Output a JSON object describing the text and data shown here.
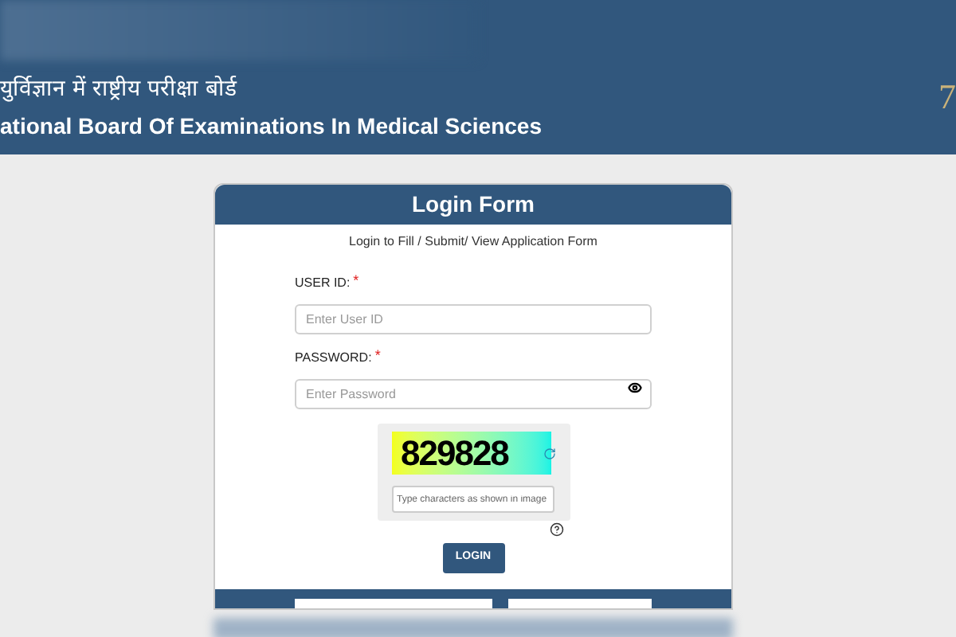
{
  "header": {
    "hindi_title": "युर्विज्ञान में राष्ट्रीय परीक्षा बोर्ड",
    "english_title": "ational Board Of Examinations In Medical Sciences",
    "logo_text": "7"
  },
  "login_form": {
    "title": "Login Form",
    "subtitle": "Login to Fill / Submit/ View Application Form",
    "fields": [
      {
        "label": "USER ID:",
        "required_mark": "*",
        "placeholder": "Enter User ID",
        "kind": "text"
      },
      {
        "label": "PASSWORD:",
        "required_mark": "*",
        "placeholder": "Enter Password",
        "kind": "password"
      }
    ],
    "captcha": {
      "code": "829828",
      "placeholder": "Type characters as shown in image"
    },
    "button": "LOGIN"
  }
}
